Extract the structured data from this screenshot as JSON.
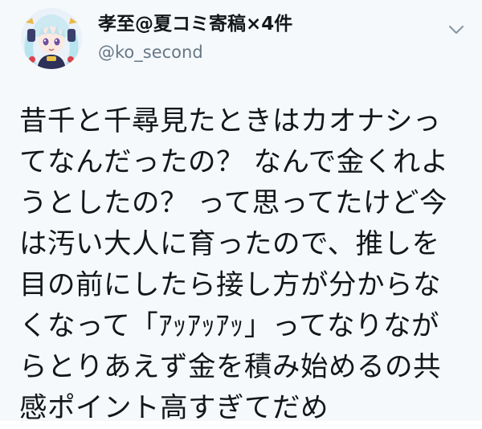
{
  "user": {
    "display_name": "孝至@夏コミ寄稿×4件",
    "handle": "@ko_second",
    "avatar_icon": "anime-character-avatar-icon"
  },
  "caret_icon": "chevron-down-icon",
  "tweet": {
    "lines": [
      "昔千と千尋見たときはカオナシっ",
      "てなんだったの？ なんで金くれよ",
      "うとしたの？ って思ってたけど今",
      "は汚い大人に育ったので、推しを",
      "目の前にしたら接し方が分からな",
      "くなって「ｱｯｱｯｱｯ」ってなりなが",
      "らとりあえず金を積み始めるの共",
      "感ポイント高すぎてだめ"
    ]
  },
  "colors": {
    "background": "#f6f9fc",
    "text": "#14171a",
    "secondary": "#657786"
  }
}
